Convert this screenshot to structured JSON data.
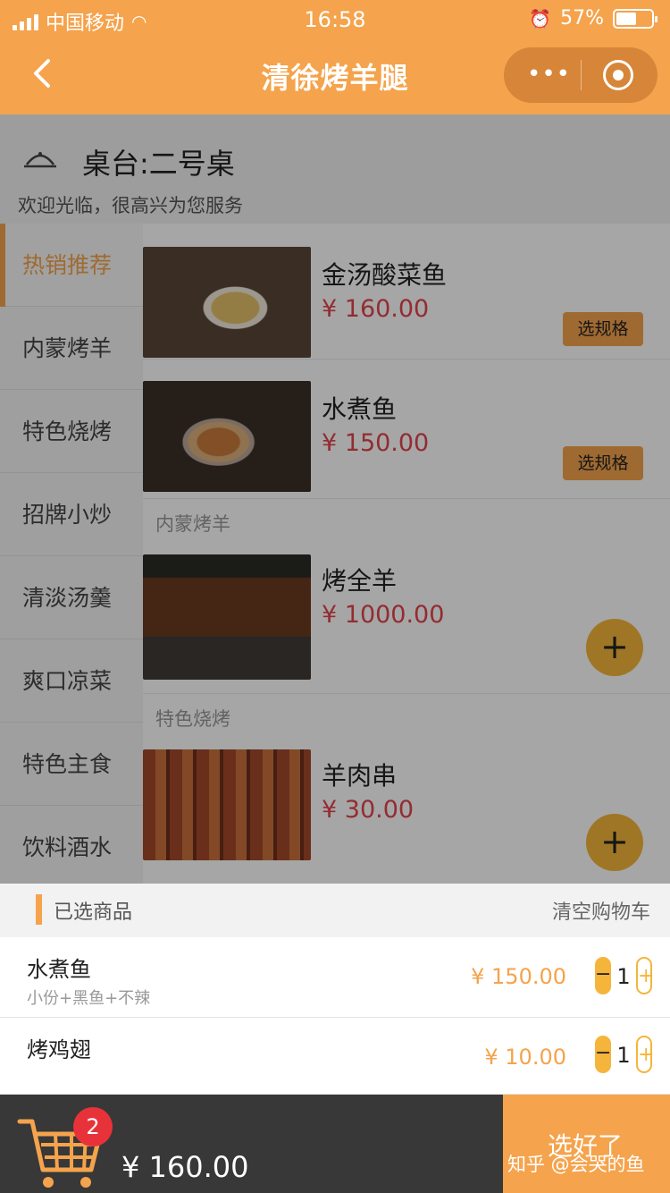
{
  "status_bar": {
    "carrier": "中国移动",
    "time": "16:58",
    "battery": "57%",
    "battery_level": 0.57
  },
  "nav": {
    "back_icon": "chevron-left-icon",
    "title": "清徐烤羊腿",
    "more_icon": "more-dots-icon",
    "more_glyph": "•••",
    "close_icon": "target-circle-icon"
  },
  "header": {
    "table": "桌台:二号桌",
    "welcome": "欢迎光临，很高兴为您服务"
  },
  "categories": [
    {
      "label": "热销推荐",
      "active": true
    },
    {
      "label": "内蒙烤羊",
      "active": false
    },
    {
      "label": "特色烧烤",
      "active": false
    },
    {
      "label": "招牌小炒",
      "active": false
    },
    {
      "label": "清淡汤羹",
      "active": false
    },
    {
      "label": "爽口凉菜",
      "active": false
    },
    {
      "label": "特色主食",
      "active": false
    },
    {
      "label": "饮料酒水",
      "active": false
    }
  ],
  "menu": {
    "sections": [
      "内蒙烤羊",
      "特色烧烤"
    ],
    "dishes": [
      {
        "name": "金汤酸菜鱼",
        "price": "¥ 160.00",
        "action": "选规格"
      },
      {
        "name": "水煮鱼",
        "price": "¥ 150.00",
        "action": "选规格"
      },
      {
        "name": "烤全羊",
        "price": "¥ 1000.00",
        "action": "+"
      },
      {
        "name": "羊肉串",
        "price": "¥ 30.00",
        "action": "+"
      }
    ]
  },
  "cart": {
    "title": "已选商品",
    "clear": "清空购物车",
    "items": [
      {
        "name": "水煮鱼",
        "spec": "小份+黑鱼+不辣",
        "price": "¥ 150.00",
        "qty": "1"
      },
      {
        "name": "烤鸡翅",
        "spec": "",
        "price": "¥ 10.00",
        "qty": "1"
      }
    ],
    "minus": "−",
    "plus": "+"
  },
  "bottom": {
    "cart_icon": "shopping-cart-icon",
    "count": "2",
    "total": "¥ 160.00",
    "confirm": "选好了"
  },
  "watermark": "知乎 @会哭的鱼",
  "colors": {
    "accent": "#f5a34c",
    "price": "#e2444c",
    "badge": "#e8323a",
    "bottom_bar": "#383838"
  }
}
